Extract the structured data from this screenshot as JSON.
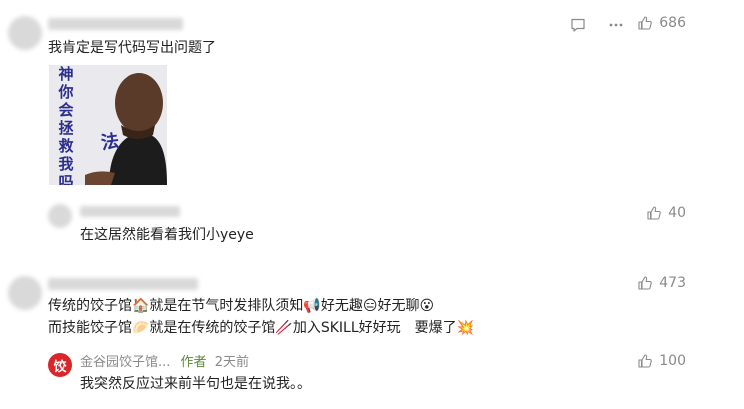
{
  "comments": [
    {
      "username": "",
      "text": "我肯定是写代码写出问题了",
      "likes": "686",
      "image": {
        "pillar_chars": [
          "神",
          "你",
          "会",
          "拯",
          "救",
          "我",
          "吗"
        ],
        "side_char": "法"
      }
    },
    {
      "username": "",
      "line1": "传统的饺子馆🏠就是在节气时发排队须知📢好无趣😑好无聊😮",
      "line2": "而技能饺子馆🥟就是在传统的饺子馆🥢加入SKILL好好玩　要爆了💥",
      "likes": "473"
    }
  ],
  "replies": [
    {
      "username": "",
      "text": "在这居然能看着我们小yeye",
      "likes": "40"
    },
    {
      "avatar_char": "饺",
      "username": "金谷园饺子馆...",
      "badge": "作者",
      "time": "2天前",
      "text": "我突然反应过来前半句也是在说我。。",
      "likes": "100"
    }
  ],
  "icons": {
    "like": "thumbs-up-icon",
    "comment": "comment-icon",
    "more": "more-icon"
  },
  "colors": {
    "author_badge": "#5a8b3a",
    "muted": "#8a8a8a",
    "author_avatar": "#d9262a"
  }
}
